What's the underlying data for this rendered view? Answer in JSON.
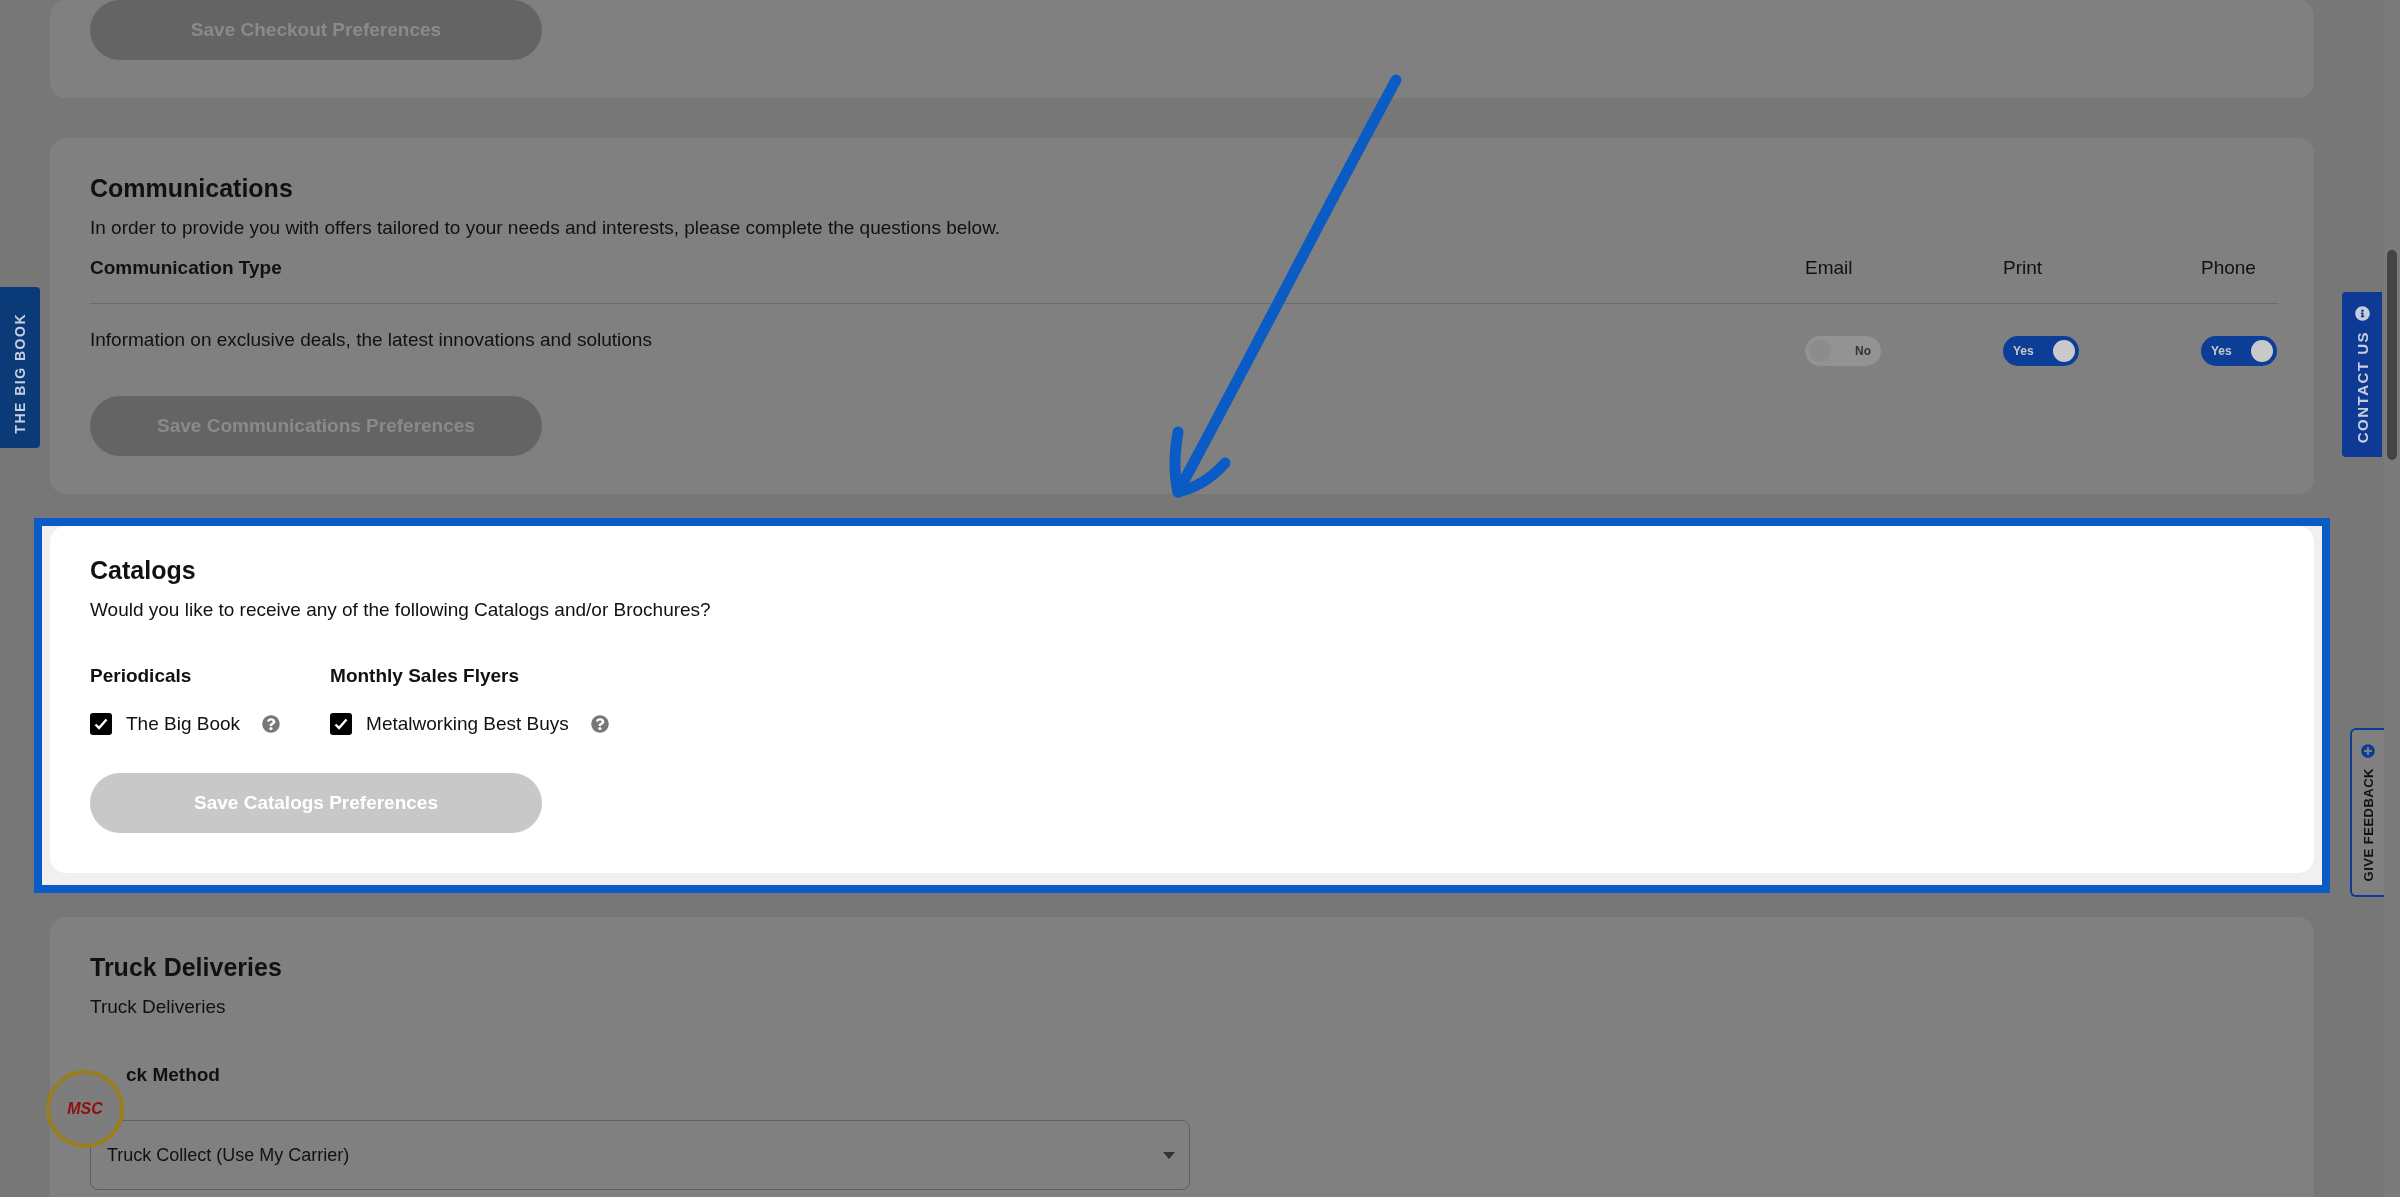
{
  "side_tabs": {
    "left": "THE BIG BOOK",
    "contact": "CONTACT US",
    "feedback": "GIVE FEEDBACK"
  },
  "sections": [
    {
      "kind": "actions",
      "highlighted": false,
      "button": {
        "label": "Save Checkout Preferences",
        "disabled": true
      }
    },
    {
      "kind": "communications",
      "highlighted": false,
      "title": "Communications",
      "description": "In order to provide you with offers tailored to your needs and interests, please complete the questions below.",
      "type_header": "Communication Type",
      "channels": [
        "Email",
        "Print",
        "Phone"
      ],
      "rows": [
        {
          "label": "Information on exclusive deals, the latest innovations and solutions",
          "toggles": [
            {
              "label": "No",
              "on": false
            },
            {
              "label": "Yes",
              "on": true
            },
            {
              "label": "Yes",
              "on": true
            }
          ]
        }
      ],
      "button": {
        "label": "Save Communications Preferences",
        "disabled": true
      }
    },
    {
      "kind": "catalogs",
      "highlighted": true,
      "title": "Catalogs",
      "description": "Would you like to receive any of the following Catalogs and/or Brochures?",
      "groups": [
        {
          "heading": "Periodicals",
          "items": [
            {
              "label": "The Big Book",
              "checked": true
            }
          ]
        },
        {
          "heading": "Monthly Sales Flyers",
          "items": [
            {
              "label": "Metalworking Best Buys",
              "checked": true
            }
          ]
        }
      ],
      "button": {
        "label": "Save Catalogs Preferences",
        "disabled": true
      }
    },
    {
      "kind": "truck",
      "highlighted": false,
      "title": "Truck Deliveries",
      "description": "Truck Deliveries",
      "field_label": "ck Method",
      "select": {
        "value": "Truck Collect (Use My Carrier)"
      }
    }
  ],
  "logo": {
    "text": "MSC"
  }
}
